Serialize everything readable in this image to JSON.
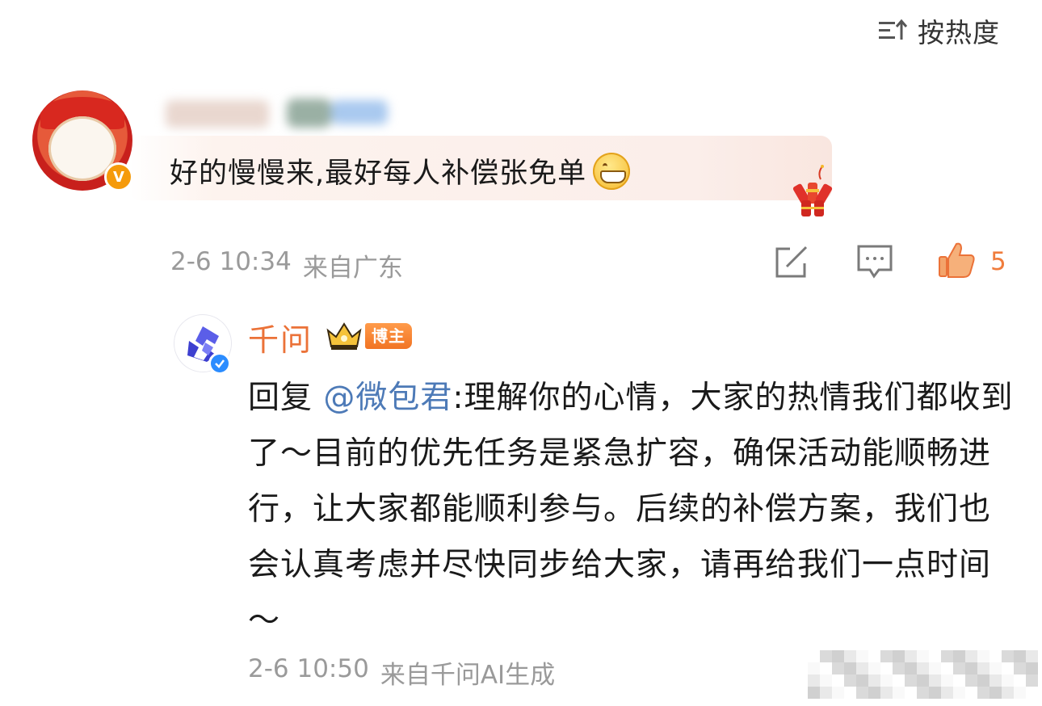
{
  "header": {
    "sort_label": "按热度",
    "sort_icon": "sort-icon"
  },
  "comment": {
    "text": "好的慢慢来,最好每人补偿张免单",
    "emoji": "grin-emoji",
    "decoration": "firecracker",
    "time": "2-6 10:34",
    "location": "来自广东",
    "like_count": "5",
    "actions": [
      "share-icon",
      "comment-icon",
      "like-icon"
    ]
  },
  "reply": {
    "author": "千问",
    "badge": "博主",
    "prefix": "回复 ",
    "mention": "@微包君",
    "text": ":理解你的心情，大家的热情我们都收到了～目前的优先任务是紧急扩容，确保活动能顺畅进行，让大家都能顺利参与。后续的补偿方案，我们也会认真考虑并尽快同步给大家，请再给我们一点时间～",
    "time": "2-6 10:50",
    "location": "来自千问AI生成"
  },
  "colors": {
    "accent_orange": "#eb7238",
    "mention_blue": "#4d7ab7",
    "meta_gray": "#9a9a9a",
    "verified_blue": "#2b8cff",
    "verified_gold": "#f59a0b"
  }
}
